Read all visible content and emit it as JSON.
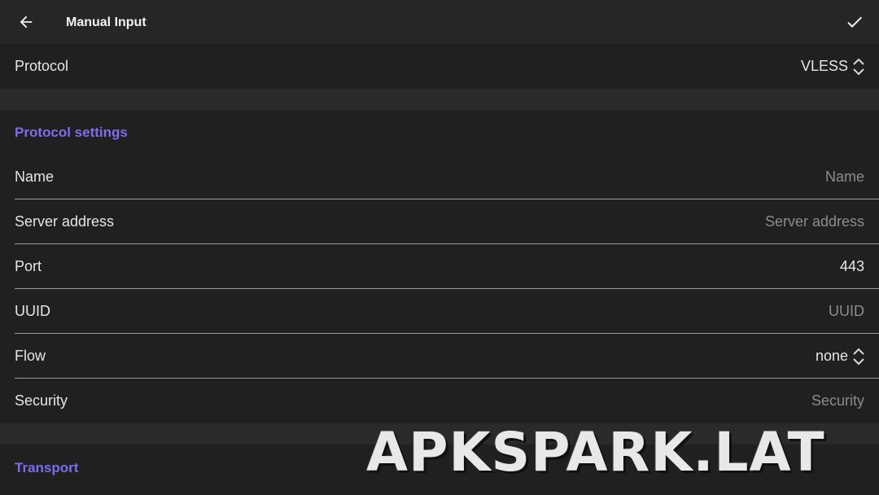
{
  "appbar": {
    "title": "Manual Input",
    "back_icon": "arrow-left-icon",
    "confirm_icon": "check-icon"
  },
  "protocol": {
    "label": "Protocol",
    "value": "VLESS"
  },
  "protocol_settings": {
    "section_title": "Protocol settings",
    "name": {
      "label": "Name",
      "placeholder": "Name",
      "value": ""
    },
    "server_address": {
      "label": "Server address",
      "placeholder": "Server address",
      "value": ""
    },
    "port": {
      "label": "Port",
      "value": "443"
    },
    "uuid": {
      "label": "UUID",
      "placeholder": "UUID",
      "value": ""
    },
    "flow": {
      "label": "Flow",
      "value": "none"
    },
    "security": {
      "label": "Security",
      "placeholder": "Security",
      "value": ""
    }
  },
  "transport": {
    "section_title": "Transport"
  },
  "watermark": "APKSPARK.LAT",
  "colors": {
    "accent": "#7b6cf0",
    "background": "#1c1c1c",
    "appbar": "#262626"
  }
}
